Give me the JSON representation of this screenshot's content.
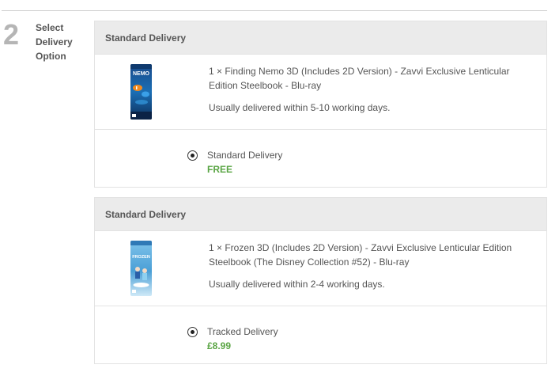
{
  "step": {
    "number": "2",
    "title": "Select Delivery Option"
  },
  "shipments": [
    {
      "header": "Standard Delivery",
      "product": {
        "name": "1 × Finding Nemo 3D (Includes 2D Version) - Zavvi Exclusive Lenticular Edition Steelbook - Blu-ray",
        "eta": "Usually delivered within 5-10 working days.",
        "image_icon": "finding-nemo-steelbook-image"
      },
      "option": {
        "label": "Standard Delivery",
        "price": "FREE",
        "selected": true
      }
    },
    {
      "header": "Standard Delivery",
      "product": {
        "name": "1 × Frozen 3D (Includes 2D Version) - Zavvi Exclusive Lenticular Edition Steelbook (The Disney Collection #52) - Blu-ray",
        "eta": "Usually delivered within 2-4 working days.",
        "image_icon": "frozen-steelbook-image"
      },
      "option": {
        "label": "Tracked Delivery",
        "price": "£8.99",
        "selected": true
      }
    }
  ],
  "colors": {
    "price_green": "#5aa544",
    "header_bg": "#ebebeb",
    "step_number_gray": "#b5b5b5"
  }
}
